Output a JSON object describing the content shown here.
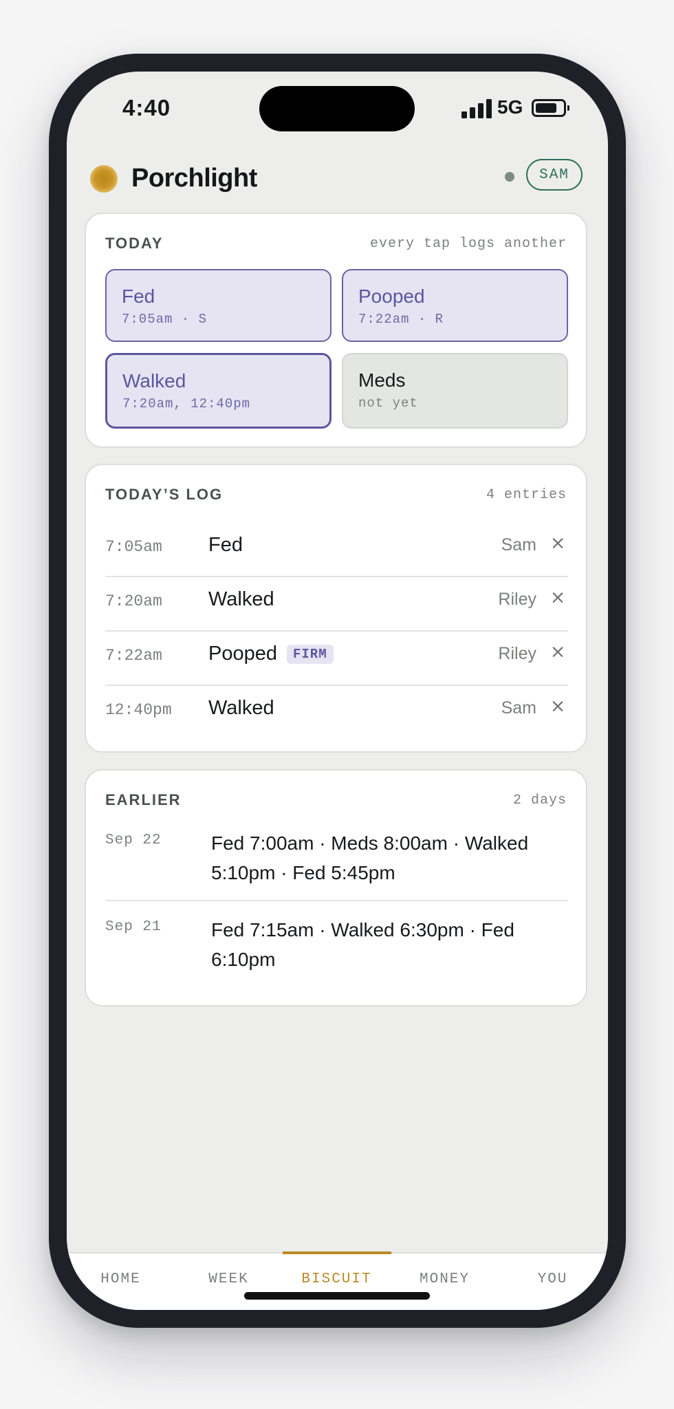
{
  "status_bar": {
    "time": "4:40",
    "network": "5G"
  },
  "header": {
    "app_name": "Porchlight",
    "user_badge": "SAM"
  },
  "today": {
    "title": "TODAY",
    "hint": "every tap logs another",
    "tiles": [
      {
        "label": "Fed",
        "sub": "7:05am · S",
        "state": "done"
      },
      {
        "label": "Pooped",
        "sub": "7:22am · R",
        "state": "done"
      },
      {
        "label": "Walked",
        "sub": "7:20am, 12:40pm",
        "state": "active"
      },
      {
        "label": "Meds",
        "sub": "not yet",
        "state": "pending"
      }
    ]
  },
  "todays_log": {
    "title": "TODAY’S LOG",
    "count": "4 entries",
    "entries": [
      {
        "time": "7:05am",
        "event": "Fed",
        "badge": "",
        "who": "Sam",
        "remove": "×"
      },
      {
        "time": "7:20am",
        "event": "Walked",
        "badge": "",
        "who": "Riley",
        "remove": "×"
      },
      {
        "time": "7:22am",
        "event": "Pooped",
        "badge": "FIRM",
        "who": "Riley",
        "remove": "×"
      },
      {
        "time": "12:40pm",
        "event": "Walked",
        "badge": "",
        "who": "Sam",
        "remove": "×"
      }
    ]
  },
  "earlier": {
    "title": "EARLIER",
    "count": "2 days",
    "days": [
      {
        "date": "Sep 22",
        "summary": "Fed 7:00am · Meds 8:00am · Walked 5:10pm · Fed 5:45pm"
      },
      {
        "date": "Sep 21",
        "summary": "Fed 7:15am · Walked 6:30pm · Fed 6:10pm"
      }
    ]
  },
  "tabs": [
    {
      "label": "HOME",
      "active": false
    },
    {
      "label": "WEEK",
      "active": false
    },
    {
      "label": "BISCUIT",
      "active": true
    },
    {
      "label": "MONEY",
      "active": false
    },
    {
      "label": "YOU",
      "active": false
    }
  ],
  "colors": {
    "accent": "#b98a26",
    "done": "#5d55a0",
    "user": "#2e6e5c"
  }
}
